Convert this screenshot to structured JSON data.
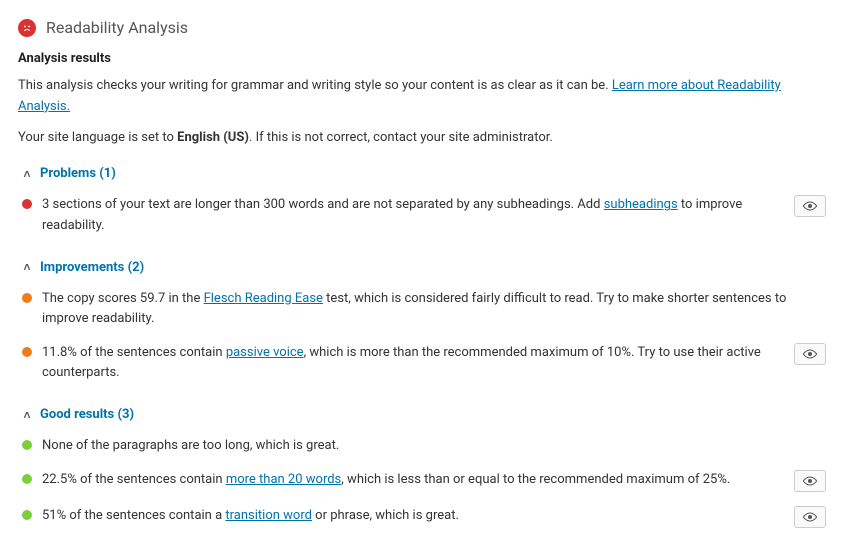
{
  "header": {
    "title": "Readability Analysis"
  },
  "results_heading": "Analysis results",
  "intro_text": "This analysis checks your writing for grammar and writing style so your content is as clear as it can be. ",
  "intro_link": "Learn more about Readability Analysis.",
  "lang_prefix": "Your site language is set to ",
  "lang_value": "English (US)",
  "lang_suffix": ". If this is not correct, contact your site administrator.",
  "sections": {
    "problems": {
      "label": "Problems (1)"
    },
    "improvements": {
      "label": "Improvements (2)"
    },
    "good": {
      "label": "Good results (3)"
    }
  },
  "items": {
    "p1_a": "3 sections of your text are longer than 300 words and are not separated by any subheadings. Add ",
    "p1_link": "subheadings",
    "p1_b": " to improve readability.",
    "i1_a": "The copy scores 59.7 in the ",
    "i1_link": "Flesch Reading Ease",
    "i1_b": " test, which is considered fairly difficult to read. Try to make shorter sentences to improve readability.",
    "i2_a": "11.8% of the sentences contain ",
    "i2_link": "passive voice",
    "i2_b": ", which is more than the recommended maximum of 10%. Try to use their active counterparts.",
    "g1": "None of the paragraphs are too long, which is great.",
    "g2_a": "22.5% of the sentences contain ",
    "g2_link": "more than 20 words",
    "g2_b": ", which is less than or equal to the recommended maximum of 25%.",
    "g3_a": "51% of the sentences contain a ",
    "g3_link": "transition word",
    "g3_b": " or phrase, which is great."
  }
}
